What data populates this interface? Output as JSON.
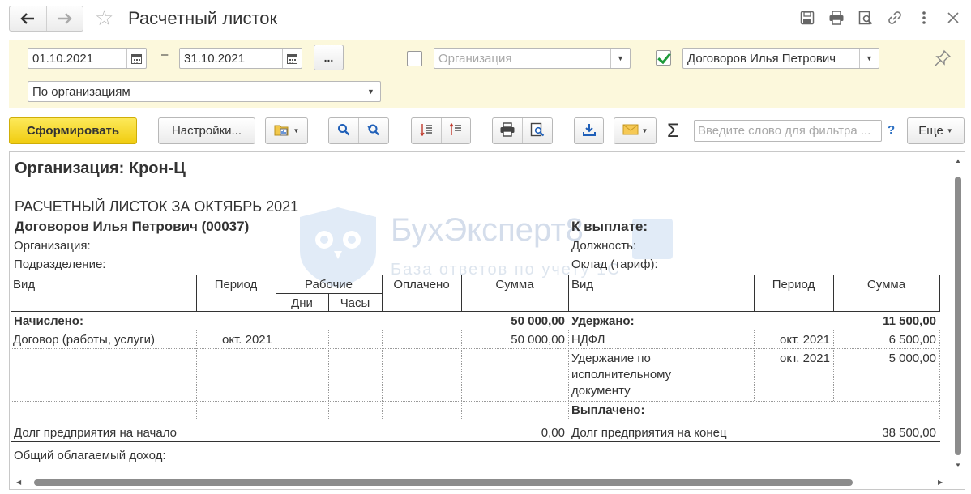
{
  "window": {
    "title": "Расчетный листок",
    "tools": [
      "save-icon",
      "print-icon",
      "preview-icon",
      "link-icon",
      "more-vertical-icon",
      "close-icon"
    ]
  },
  "filters": {
    "date_from": "01.10.2021",
    "date_to": "31.10.2021",
    "dash": "–",
    "period_button": "...",
    "organization_checked": false,
    "organization_placeholder": "Организация",
    "employee_checked": true,
    "employee_value": "Договоров Илья Петрович",
    "grouping_value": "По организациям"
  },
  "toolbar": {
    "generate_label": "Сформировать",
    "settings_label": "Настройки...",
    "filter_placeholder": "Введите слово для фильтра ...",
    "help_label": "?",
    "more_label": "Еще",
    "sigma_label": "Σ"
  },
  "report": {
    "organization_title": "Организация: Крон-Ц",
    "sheet_title": "РАСЧЕТНЫЙ ЛИСТОК ЗА ОКТЯБРЬ 2021",
    "employee": "Договоров Илья Петрович (00037)",
    "to_pay_label": "К выплате:",
    "organization_label": "Организация:",
    "position_label": "Должность:",
    "department_label": "Подразделение:",
    "salary_label": "Оклад (тариф):",
    "left_headers": {
      "kind": "Вид",
      "period": "Период",
      "working": "Рабочие",
      "days": "Дни",
      "hours": "Часы",
      "paid": "Оплачено",
      "sum": "Сумма"
    },
    "right_headers": {
      "kind": "Вид",
      "period": "Период",
      "sum": "Сумма"
    },
    "accrued_label": "Начислено:",
    "accrued_total": "50 000,00",
    "withheld_label": "Удержано:",
    "withheld_total": "11 500,00",
    "accruals": [
      {
        "kind": "Договор (работы, услуги)",
        "period": "окт. 2021",
        "sum": "50 000,00"
      }
    ],
    "withholdings": [
      {
        "kind": "НДФЛ",
        "period": "окт. 2021",
        "sum": "6 500,00"
      },
      {
        "kind_lines": [
          "Удержание по",
          "исполнительному",
          "документу"
        ],
        "period": "окт. 2021",
        "sum": "5 000,00"
      }
    ],
    "paid_label": "Выплачено:",
    "debt_start_label": "Долг предприятия на начало",
    "debt_start_value": "0,00",
    "debt_end_label": "Долг предприятия на конец",
    "debt_end_value": "38 500,00",
    "taxable_income_label": "Общий облагаемый доход:",
    "watermark_title": "БухЭксперт8",
    "watermark_subtitle": "База ответов по учету 1С"
  }
}
